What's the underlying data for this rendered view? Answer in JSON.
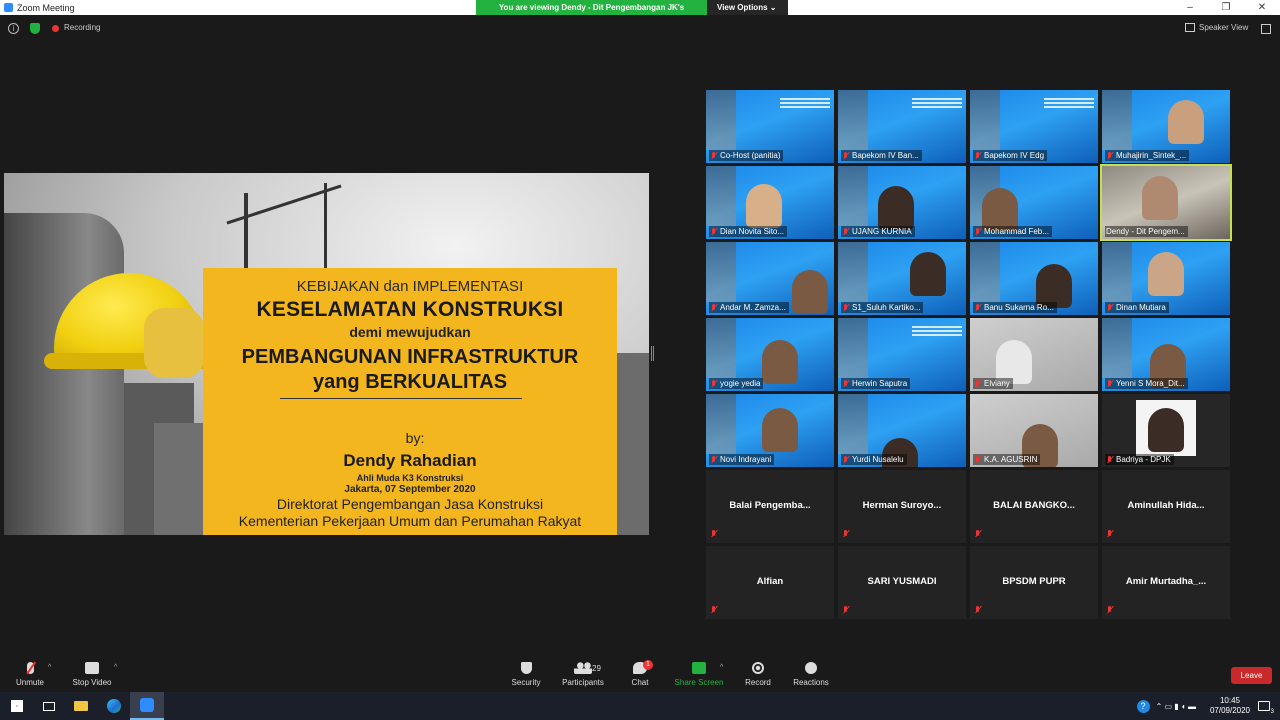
{
  "window": {
    "title": "Zoom Meeting",
    "controls": [
      "–",
      "❐",
      "✕"
    ]
  },
  "share_banner": {
    "text": "You are viewing Dendy - Dit Pengembangan JK's screen",
    "view_options": "View Options ⌄"
  },
  "topbar": {
    "info": "i",
    "recording_label": "Recording",
    "speaker_view_label": "Speaker View"
  },
  "slide": {
    "line1": "KEBIJAKAN dan IMPLEMENTASI",
    "line2": "KESELAMATAN KONSTRUKSI",
    "line3": "demi mewujudkan",
    "line4": "PEMBANGUNAN INFRASTRUKTUR",
    "line5": "yang BERKUALITAS",
    "by": "by:",
    "presenter": "Dendy Rahadian",
    "role": "Ahli Muda K3 Konstruksi",
    "date": "Jakarta, 07 September 2020",
    "org1": "Direktorat Pengembangan Jasa Konstruksi",
    "org2": "Kementerian Pekerjaan Umum dan Perumahan Rakyat"
  },
  "participants": [
    "Co-Host (panitia)",
    "Bapekom IV Ban...",
    "Bapekom IV Edg",
    "Muhajirin_Sintek_...",
    "Dian Novita Sito...",
    "UJANG KURNIA",
    "Mohammad Feb...",
    "Dendy - Dit Pengem...",
    "Andar M. Zamza...",
    "S1_Suluh Kartiko...",
    "Banu Sukarna Ro...",
    "Dinan Mutiara",
    "yogie yedia",
    "Herwin Saputra",
    "Elviany",
    "Yenni S Mora_Dit...",
    "Novi Indrayani",
    "Yurdi Nusalelu",
    "K.A. AGUSRIN",
    "Badriya - DPJK",
    "Balai  Pengemba...",
    "Herman  Suroyo...",
    "BALAI  BANGKO...",
    "Aminullah  Hida...",
    "Alfian",
    "SARI YUSMADI",
    "BPSDM PUPR",
    "Amir  Murtadha_..."
  ],
  "toolbar": {
    "unmute": "Unmute",
    "stop_video": "Stop Video",
    "security": "Security",
    "participants": "Participants",
    "participants_count": "29",
    "chat": "Chat",
    "chat_badge": "1",
    "share_screen": "Share Screen",
    "record": "Record",
    "reactions": "Reactions",
    "leave": "Leave"
  },
  "taskbar": {
    "time": "10:45",
    "date": "07/09/2020",
    "help": "?",
    "notifications": "3"
  },
  "colors": {
    "accent_green": "#23b13f",
    "zoom_blue": "#2d8cff",
    "leave_red": "#c9292b",
    "slide_yellow": "#f3b61e",
    "active_speaker": "#c6e04d"
  }
}
